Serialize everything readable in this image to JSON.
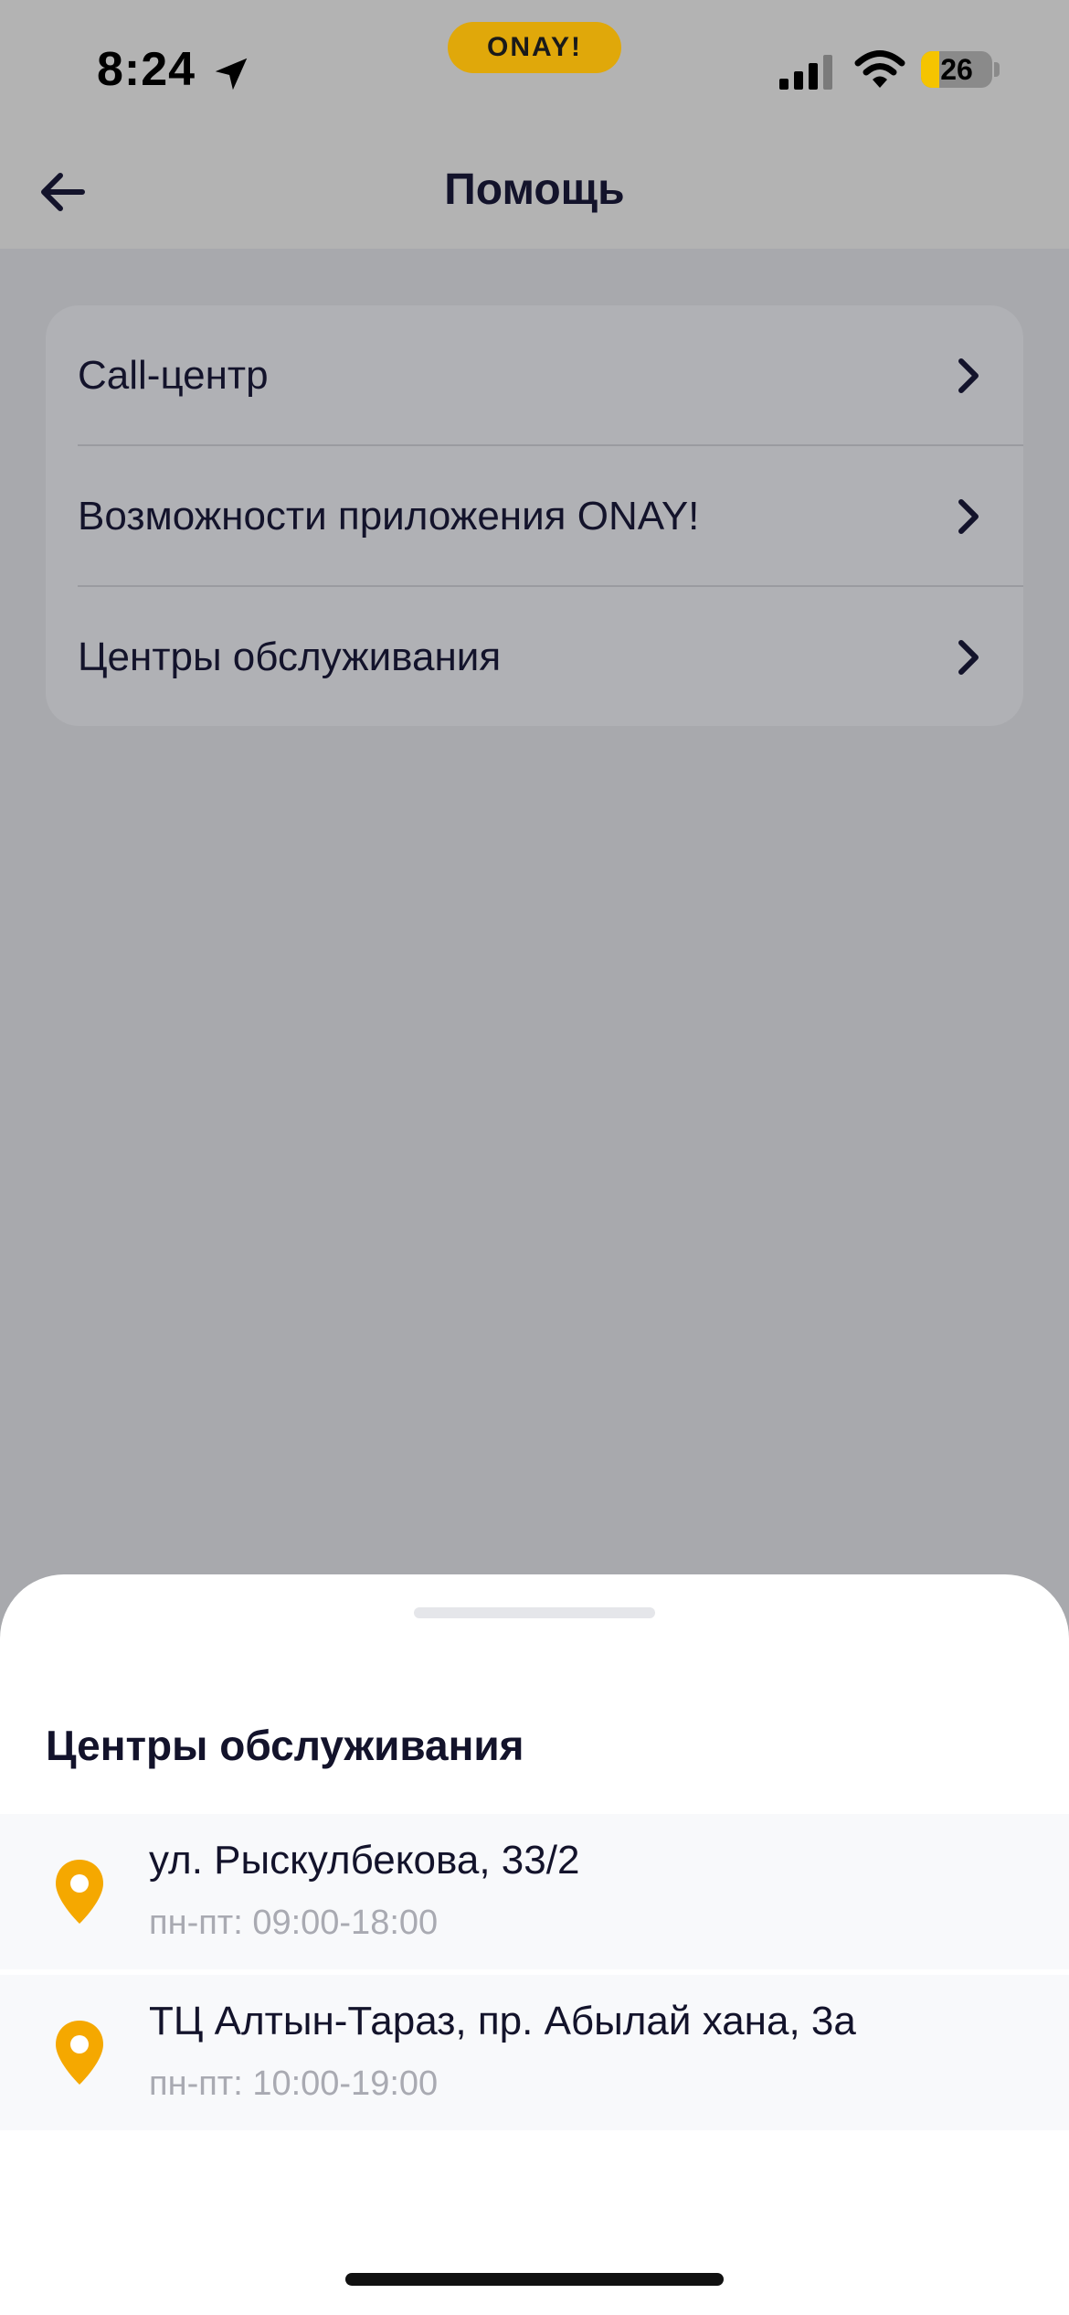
{
  "status_bar": {
    "time": "8:24",
    "app_badge": "ONAY!",
    "battery_level": "26",
    "battery_fraction": 0.26
  },
  "header": {
    "title": "Помощь",
    "back_icon": "arrow-left-icon"
  },
  "menu": {
    "items": [
      {
        "label": "Call-центр"
      },
      {
        "label": "Возможности приложения ONAY!"
      },
      {
        "label": "Центры обслуживания"
      }
    ]
  },
  "sheet": {
    "title": "Центры обслуживания",
    "centers": [
      {
        "address": "ул. Рыскулбекова, 33/2",
        "hours": "пн-пт: 09:00-18:00"
      },
      {
        "address": "ТЦ Алтын-Тараз, пр. Абылай хана, 3а",
        "hours": "пн-пт: 10:00-19:00"
      }
    ]
  },
  "colors": {
    "accent": "#F5A800",
    "text_primary": "#13132B",
    "text_secondary": "#A9AAB2",
    "overlay": "#A8A9AD"
  }
}
